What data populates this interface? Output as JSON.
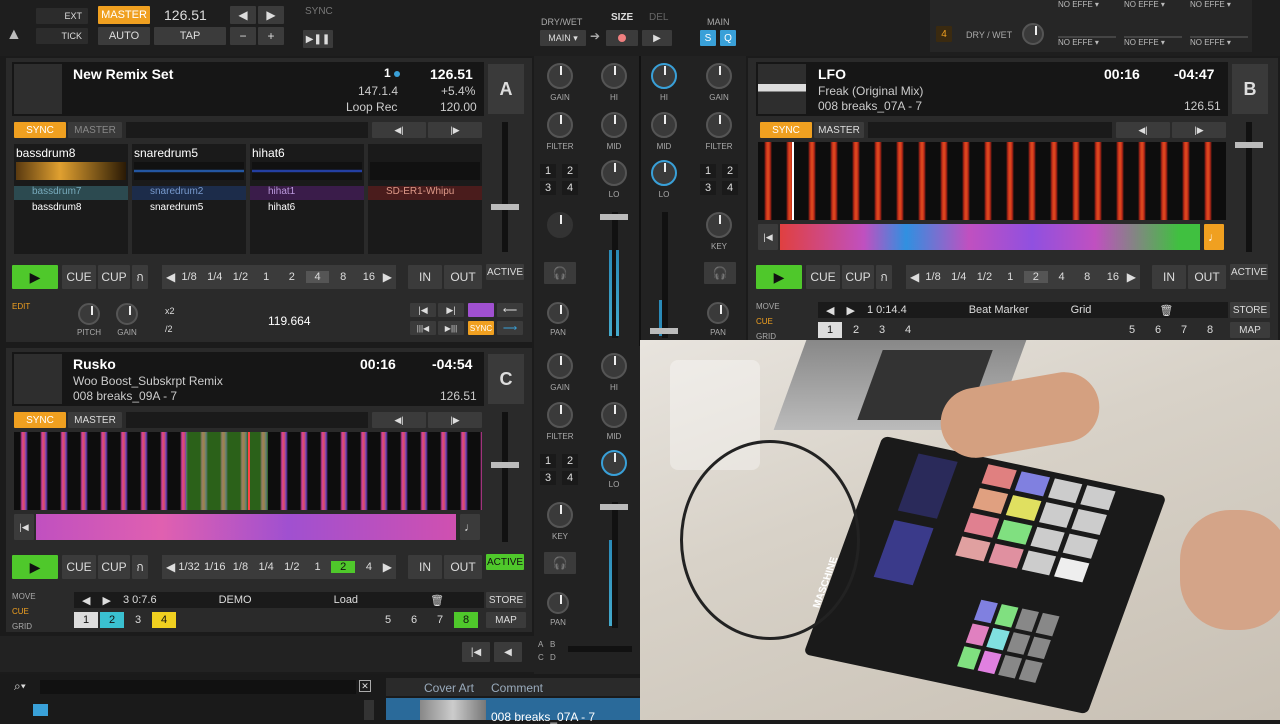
{
  "top": {
    "ext": "EXT",
    "tick": "TICK",
    "master": "MASTER",
    "tempo": "126.51",
    "auto": "AUTO",
    "tap": "TAP",
    "minus": "−",
    "plus": "+",
    "sync": "SYNC",
    "drywet": "DRY/WET",
    "size": "SIZE",
    "del": "DEL",
    "main": "MAIN",
    "main_sel": "MAIN",
    "s": "S",
    "q": "Q",
    "fx_drywet": "DRY / WET",
    "fx4": "4",
    "no_effect": "NO EFFE"
  },
  "deckA": {
    "title": "New Remix Set",
    "beat": "1",
    "tempo": "126.51",
    "pos": "147.1.4",
    "pct": "+5.4%",
    "mode": "Loop Rec",
    "loop_tempo": "120.00",
    "letter": "A",
    "sync": "SYNC",
    "master": "MASTER",
    "slots": [
      {
        "name": "bassdrum8",
        "s1": "bassdrum7",
        "s2": "bassdrum8"
      },
      {
        "name": "snaredrum5",
        "s1": "snaredrum2",
        "s2": "snaredrum5"
      },
      {
        "name": "hihat6",
        "s1": "hihat1",
        "s2": "hihat6"
      },
      {
        "name": "",
        "s1": "SD-ER1-Whipu",
        "s2": ""
      }
    ],
    "cue": "CUE",
    "cup": "CUP",
    "loops": [
      "1/8",
      "1/4",
      "1/2",
      "1",
      "2",
      "4",
      "8",
      "16"
    ],
    "in": "IN",
    "out": "OUT",
    "active": "ACTIVE",
    "edit": "EDIT",
    "pitch": "PITCH",
    "gain": "GAIN",
    "x2": "x2",
    "d2": "/2",
    "bpm": "119.664",
    "sync2": "SYNC"
  },
  "deckB": {
    "title": "LFO",
    "time": "00:16",
    "remain": "-04:47",
    "track": "Freak (Original Mix)",
    "album": "008 breaks_07A - 7",
    "tempo": "126.51",
    "letter": "B",
    "sync": "SYNC",
    "master": "MASTER",
    "cue": "CUE",
    "cup": "CUP",
    "loops": [
      "1/8",
      "1/4",
      "1/2",
      "1",
      "2",
      "4",
      "8",
      "16"
    ],
    "in": "IN",
    "out": "OUT",
    "active": "ACTIVE",
    "move": "MOVE",
    "cue2": "CUE",
    "grid": "GRID",
    "pos": "1 0:14.4",
    "marker": "Beat Marker",
    "gridsel": "Grid",
    "store": "STORE",
    "map": "MAP",
    "hot": [
      "1",
      "2",
      "3",
      "4"
    ],
    "hot2": [
      "5",
      "6",
      "7",
      "8"
    ]
  },
  "deckC": {
    "title": "Rusko",
    "time": "00:16",
    "remain": "-04:54",
    "track": "Woo Boost_Subskrpt Remix",
    "album": "008 breaks_09A - 7",
    "tempo": "126.51",
    "letter": "C",
    "sync": "SYNC",
    "master": "MASTER",
    "cue": "CUE",
    "cup": "CUP",
    "loops": [
      "1/32",
      "1/16",
      "1/8",
      "1/4",
      "1/2",
      "1",
      "2",
      "4"
    ],
    "in": "IN",
    "out": "OUT",
    "active": "ACTIVE",
    "move": "MOVE",
    "cue2": "CUE",
    "grid": "GRID",
    "pos": "3 0:7.6",
    "demo": "DEMO",
    "load": "Load",
    "store": "STORE",
    "map": "MAP",
    "hot": [
      "1",
      "2",
      "3",
      "4"
    ],
    "hot2": [
      "5",
      "6",
      "7",
      "8"
    ]
  },
  "mixer": {
    "gain": "GAIN",
    "hi": "HI",
    "mid": "MID",
    "lo": "LO",
    "filter": "FILTER",
    "key": "KEY",
    "pan": "PAN",
    "n1": "1",
    "n2": "2",
    "n3": "3",
    "n4": "4"
  },
  "browser": {
    "cover": "Cover Art",
    "comment": "Comment",
    "row": "008 breaks_07A - 7"
  },
  "cross": {
    "a": "A",
    "b": "B",
    "c": "C",
    "d": "D"
  },
  "photo": {
    "brand": "MASCHINE"
  }
}
